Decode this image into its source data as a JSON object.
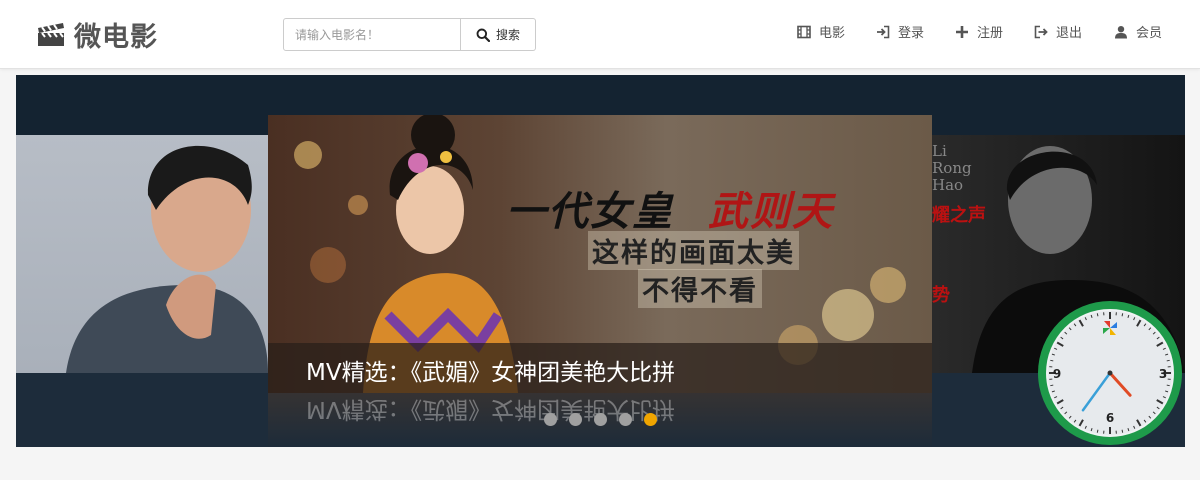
{
  "brand": {
    "name": "微电影",
    "icon": "clapperboard-icon"
  },
  "search": {
    "placeholder": "请输入电影名！",
    "value": "",
    "button_label": "搜索",
    "icon": "search-icon"
  },
  "nav": {
    "items": [
      {
        "label": "电影",
        "icon": "film-icon"
      },
      {
        "label": "登录",
        "icon": "login-icon"
      },
      {
        "label": "注册",
        "icon": "plus-icon"
      },
      {
        "label": "退出",
        "icon": "logout-icon"
      },
      {
        "label": "会员",
        "icon": "user-icon"
      }
    ]
  },
  "carousel": {
    "caption": "MV精选：《武媚》女神团美艳大比拼",
    "slide_text": {
      "title_black": "一代女皇",
      "title_red": "武则天",
      "line1": "这样的画面太美",
      "line2": "不得不看"
    },
    "side_right_text": {
      "name_lines": [
        "Li",
        "Rong",
        "Hao"
      ],
      "tag": "耀之声",
      "tag2": "势"
    },
    "dots_total": 5,
    "active_dot": 5
  },
  "clock": {
    "numerals": [
      "9",
      "3",
      "6"
    ],
    "time": "4:36"
  },
  "colors": {
    "accent": "#f0a500",
    "clock_ring": "#1e9a4a",
    "carousel_bg": "#1b2836"
  }
}
